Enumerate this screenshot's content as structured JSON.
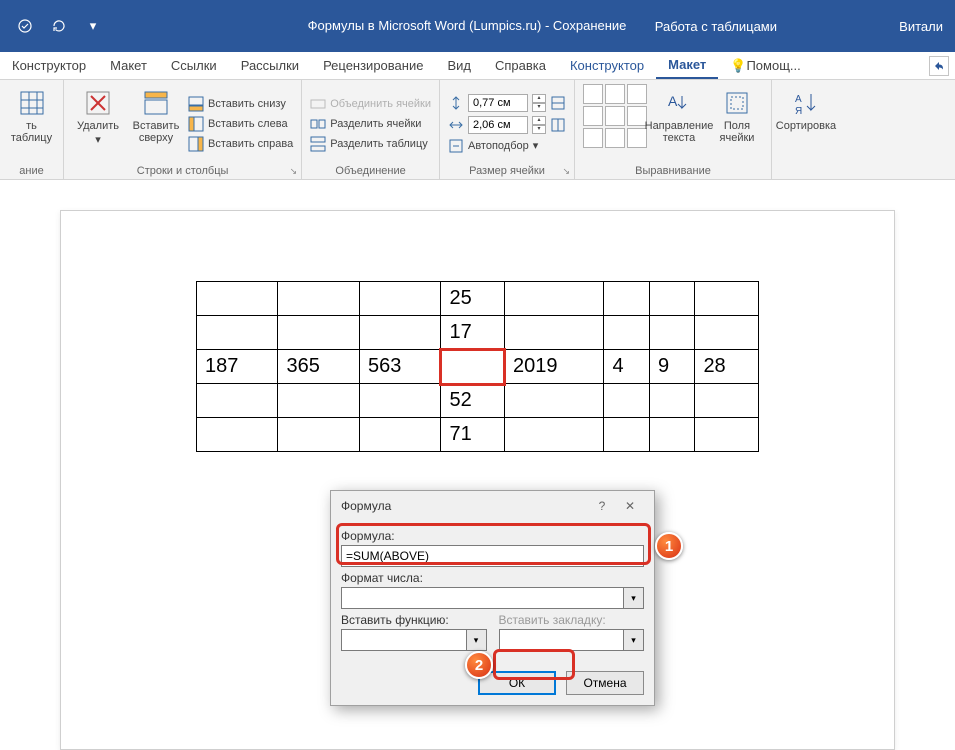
{
  "titlebar": {
    "doc_title": "Формулы в Microsoft Word (Lumpics.ru)  -  Сохранение...  ▾",
    "context_tab": "Работа с таблицами",
    "user": "Витали"
  },
  "tabs": {
    "constructor1": "Конструктор",
    "layout1": "Макет",
    "references": "Ссылки",
    "mailings": "Рассылки",
    "review": "Рецензирование",
    "view": "Вид",
    "help": "Справка",
    "constructor2": "Конструктор",
    "layout2": "Макет",
    "tellme": "Помощ..."
  },
  "ribbon": {
    "draw_table": "ть таблицу",
    "draw_group": "ание",
    "delete": "Удалить",
    "insert_above": "Вставить\nсверху",
    "insert_below": "Вставить снизу",
    "insert_left": "Вставить слева",
    "insert_right": "Вставить справа",
    "rows_cols_group": "Строки и столбцы",
    "merge_cells": "Объединить ячейки",
    "split_cells": "Разделить ячейки",
    "split_table": "Разделить таблицу",
    "merge_group": "Объединение",
    "height_val": "0,77 см",
    "width_val": "2,06 см",
    "autofit": "Автоподбор",
    "cell_size_group": "Размер ячейки",
    "text_direction": "Направление\nтекста",
    "cell_margins": "Поля\nячейки",
    "alignment_group": "Выравнивание",
    "sort": "Сортировка"
  },
  "table": {
    "r1": [
      "",
      "",
      "",
      "25",
      "",
      "",
      "",
      ""
    ],
    "r2": [
      "",
      "",
      "",
      "17",
      "",
      "",
      "",
      ""
    ],
    "r3": [
      "187",
      "365",
      "563",
      "",
      "2019",
      "4",
      "9",
      "28"
    ],
    "r4": [
      "",
      "",
      "",
      "52",
      "",
      "",
      "",
      ""
    ],
    "r5": [
      "",
      "",
      "",
      "71",
      "",
      "",
      "",
      ""
    ]
  },
  "dialog": {
    "title": "Формула",
    "formula_label": "Формула:",
    "formula_value": "=SUM(ABOVE)",
    "number_format_label": "Формат числа:",
    "insert_function_label": "Вставить функцию:",
    "insert_bookmark_label": "Вставить закладку:",
    "ok": "ОК",
    "cancel": "Отмена"
  },
  "markers": {
    "one": "1",
    "two": "2"
  }
}
